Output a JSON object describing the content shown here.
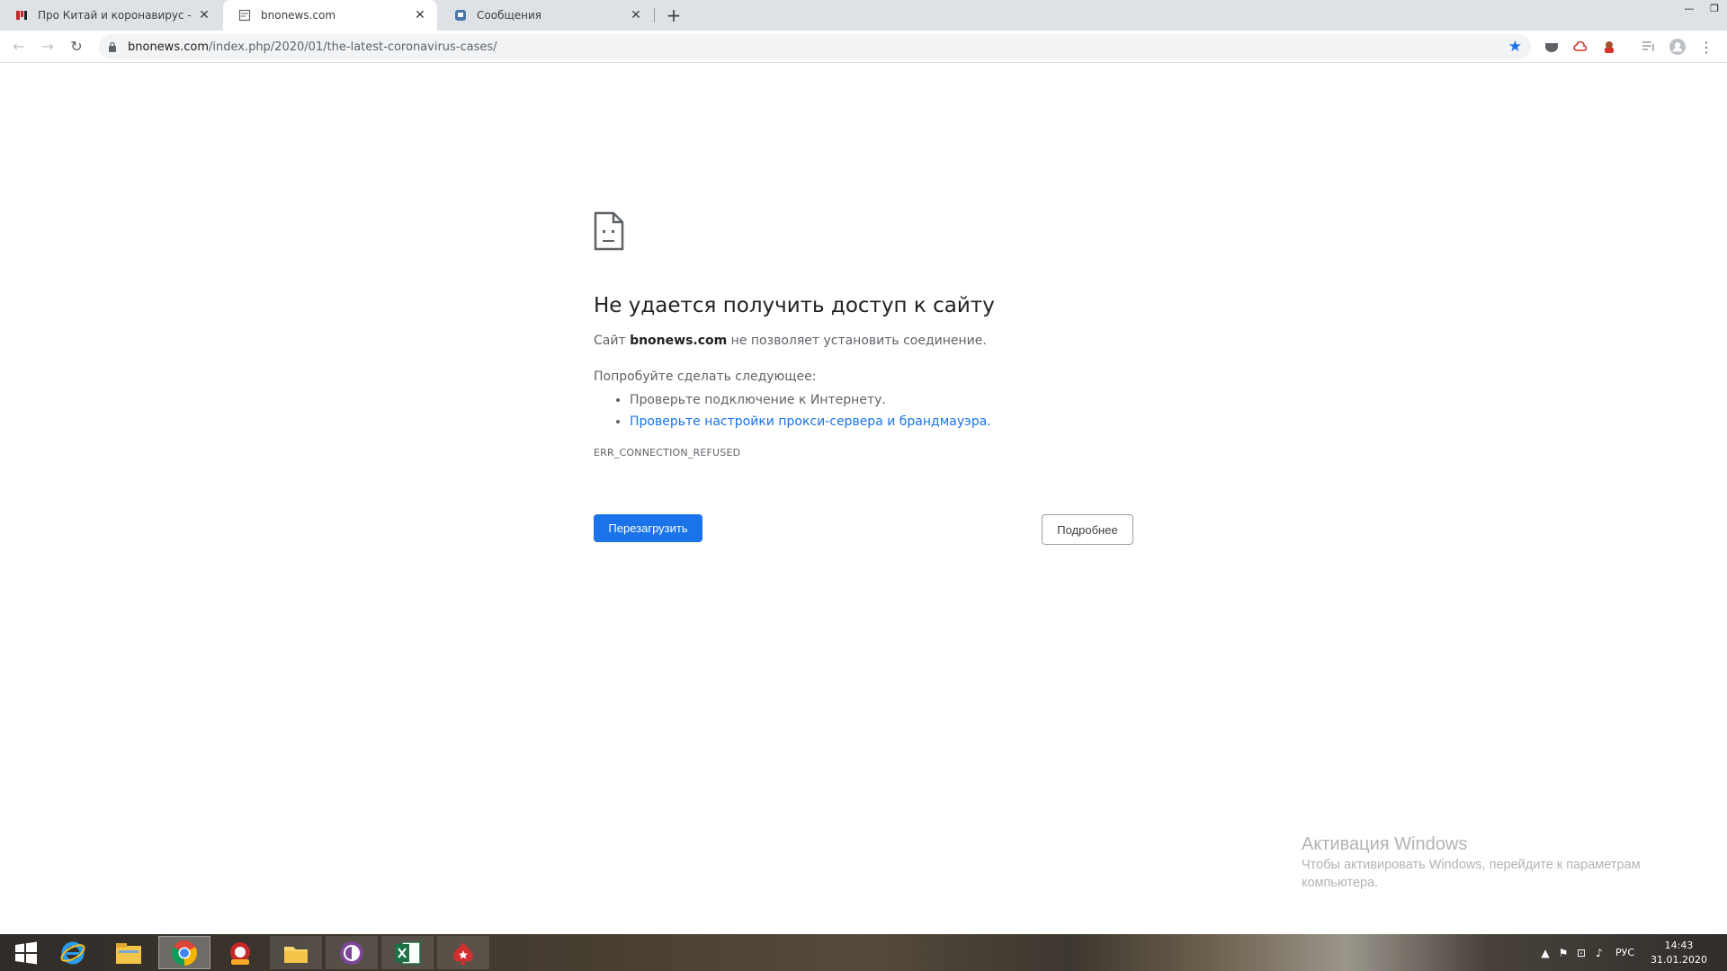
{
  "browser": {
    "tabs": [
      {
        "title": "Про Китай и коронавирус - ЯП",
        "icon": "yaplakal-favicon"
      },
      {
        "title": "bnonews.com",
        "icon": "broken-page-favicon"
      },
      {
        "title": "Сообщения",
        "icon": "vk-messages-favicon"
      }
    ],
    "new_tab": "+",
    "window_controls": {
      "minimize": "—",
      "restore": "❐"
    },
    "url_host": "bnonews.com",
    "url_path": "/index.php/2020/01/the-latest-coronavirus-cases/"
  },
  "error_page": {
    "heading": "Не удается получить доступ к сайту",
    "summary_prefix": "Сайт ",
    "summary_host": "bnonews.com",
    "summary_suffix": " не позволяет установить соединение.",
    "try_label": "Попробуйте сделать следующее:",
    "suggestions": [
      "Проверьте подключение к Интернету.",
      "Проверьте настройки прокси-сервера и брандмауэра."
    ],
    "error_code": "ERR_CONNECTION_REFUSED",
    "reload_label": "Перезагрузить",
    "details_label": "Подробнее"
  },
  "watermark": {
    "title": "Активация Windows",
    "text": "Чтобы активировать Windows, перейдите к параметрам компьютера."
  },
  "taskbar": {
    "apps": [
      "start",
      "internet-explorer",
      "file-explorer",
      "chrome",
      "poker-app",
      "folder-app",
      "tor-browser",
      "excel",
      "pokerstars"
    ],
    "tray": {
      "language": "РУС",
      "time": "14:43",
      "date": "31.01.2020"
    }
  },
  "colors": {
    "accent": "#1a73e8",
    "tab_strip": "#dee1e6"
  }
}
